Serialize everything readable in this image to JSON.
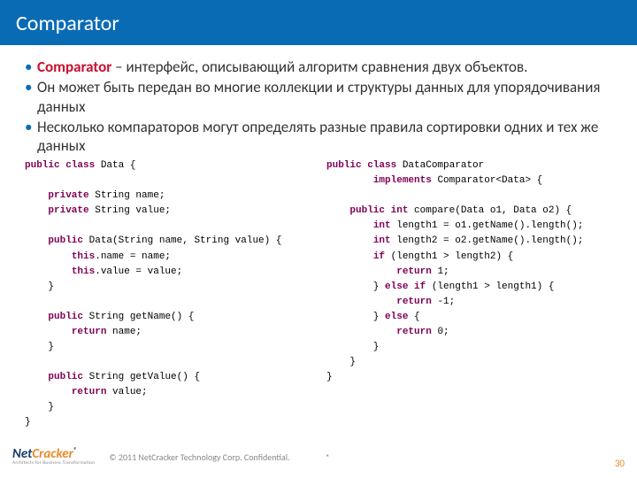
{
  "title": "Comparator",
  "bullets": [
    {
      "term": "Comparator",
      "rest": " – интерфейс, описывающий алгоритм сравнения двух объектов."
    },
    {
      "term": "",
      "rest": "Он может быть передан во многие  коллекции и структуры данных для упорядочивания данных"
    },
    {
      "term": "",
      "rest": "Несколько компараторов могут определять разные правила сортировки одних и тех же данных"
    }
  ],
  "code_left": [
    {
      "indent": 0,
      "tokens": [
        {
          "t": "public class ",
          "c": "kw"
        },
        {
          "t": "Data {",
          "c": "cls"
        }
      ]
    },
    {
      "indent": 0,
      "tokens": [
        {
          "t": "",
          "c": ""
        }
      ]
    },
    {
      "indent": 1,
      "tokens": [
        {
          "t": "private ",
          "c": "kw"
        },
        {
          "t": "String name;",
          "c": ""
        }
      ]
    },
    {
      "indent": 1,
      "tokens": [
        {
          "t": "private ",
          "c": "kw"
        },
        {
          "t": "String value;",
          "c": ""
        }
      ]
    },
    {
      "indent": 0,
      "tokens": [
        {
          "t": "",
          "c": ""
        }
      ]
    },
    {
      "indent": 1,
      "tokens": [
        {
          "t": "public ",
          "c": "kw"
        },
        {
          "t": "Data(String name, String value) {",
          "c": ""
        }
      ]
    },
    {
      "indent": 2,
      "tokens": [
        {
          "t": "this",
          "c": "kw"
        },
        {
          "t": ".name = name;",
          "c": ""
        }
      ]
    },
    {
      "indent": 2,
      "tokens": [
        {
          "t": "this",
          "c": "kw"
        },
        {
          "t": ".value = value;",
          "c": ""
        }
      ]
    },
    {
      "indent": 1,
      "tokens": [
        {
          "t": "}",
          "c": ""
        }
      ]
    },
    {
      "indent": 0,
      "tokens": [
        {
          "t": "",
          "c": ""
        }
      ]
    },
    {
      "indent": 1,
      "tokens": [
        {
          "t": "public ",
          "c": "kw"
        },
        {
          "t": "String getName() {",
          "c": ""
        }
      ]
    },
    {
      "indent": 2,
      "tokens": [
        {
          "t": "return ",
          "c": "kw"
        },
        {
          "t": "name;",
          "c": ""
        }
      ]
    },
    {
      "indent": 1,
      "tokens": [
        {
          "t": "}",
          "c": ""
        }
      ]
    },
    {
      "indent": 0,
      "tokens": [
        {
          "t": "",
          "c": ""
        }
      ]
    },
    {
      "indent": 1,
      "tokens": [
        {
          "t": "public ",
          "c": "kw"
        },
        {
          "t": "String getValue() {",
          "c": ""
        }
      ]
    },
    {
      "indent": 2,
      "tokens": [
        {
          "t": "return ",
          "c": "kw"
        },
        {
          "t": "value;",
          "c": ""
        }
      ]
    },
    {
      "indent": 1,
      "tokens": [
        {
          "t": "}",
          "c": ""
        }
      ]
    },
    {
      "indent": 0,
      "tokens": [
        {
          "t": "}",
          "c": ""
        }
      ]
    }
  ],
  "code_right": [
    {
      "indent": 0,
      "tokens": [
        {
          "t": "public class ",
          "c": "kw"
        },
        {
          "t": "DataComparator",
          "c": ""
        }
      ]
    },
    {
      "indent": 2,
      "tokens": [
        {
          "t": "implements ",
          "c": "kw"
        },
        {
          "t": "Comparator<Data> {",
          "c": ""
        }
      ]
    },
    {
      "indent": 0,
      "tokens": [
        {
          "t": "",
          "c": ""
        }
      ]
    },
    {
      "indent": 1,
      "tokens": [
        {
          "t": "public int ",
          "c": "kw"
        },
        {
          "t": "compare(Data o1, Data o2) {",
          "c": ""
        }
      ]
    },
    {
      "indent": 2,
      "tokens": [
        {
          "t": "int ",
          "c": "kw"
        },
        {
          "t": "length1 = o1.getName().length();",
          "c": ""
        }
      ]
    },
    {
      "indent": 2,
      "tokens": [
        {
          "t": "int ",
          "c": "kw"
        },
        {
          "t": "length2 = o2.getName().length();",
          "c": ""
        }
      ]
    },
    {
      "indent": 2,
      "tokens": [
        {
          "t": "if ",
          "c": "kw"
        },
        {
          "t": "(length1 > length2) {",
          "c": ""
        }
      ]
    },
    {
      "indent": 3,
      "tokens": [
        {
          "t": "return ",
          "c": "kw"
        },
        {
          "t": "1;",
          "c": ""
        }
      ]
    },
    {
      "indent": 2,
      "tokens": [
        {
          "t": "} ",
          "c": ""
        },
        {
          "t": "else if ",
          "c": "kw"
        },
        {
          "t": "(length1 > length1) {",
          "c": ""
        }
      ]
    },
    {
      "indent": 3,
      "tokens": [
        {
          "t": "return ",
          "c": "kw"
        },
        {
          "t": "-1;",
          "c": ""
        }
      ]
    },
    {
      "indent": 2,
      "tokens": [
        {
          "t": "} ",
          "c": ""
        },
        {
          "t": "else ",
          "c": "kw"
        },
        {
          "t": "{",
          "c": ""
        }
      ]
    },
    {
      "indent": 3,
      "tokens": [
        {
          "t": "return ",
          "c": "kw"
        },
        {
          "t": "0;",
          "c": ""
        }
      ]
    },
    {
      "indent": 2,
      "tokens": [
        {
          "t": "}",
          "c": ""
        }
      ]
    },
    {
      "indent": 1,
      "tokens": [
        {
          "t": "}",
          "c": ""
        }
      ]
    },
    {
      "indent": 0,
      "tokens": [
        {
          "t": "}",
          "c": ""
        }
      ]
    }
  ],
  "footer": {
    "logo_main_left": "Net",
    "logo_main_right": "Cracker",
    "logo_reg": "®",
    "logo_sub": "Architects for Business Transformation",
    "copyright": "© 2011 NetCracker Technology Corp. Confidential.",
    "star": "*",
    "page": "30"
  }
}
